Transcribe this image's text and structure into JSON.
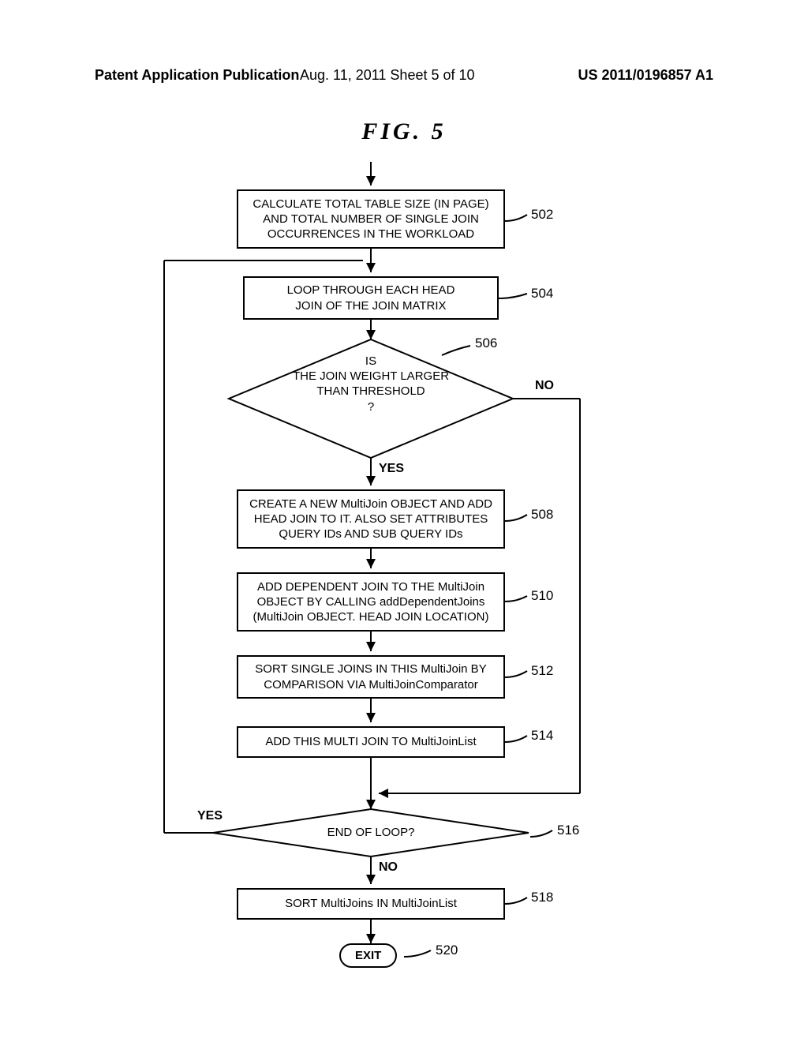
{
  "header": {
    "left": "Patent Application Publication",
    "center": "Aug. 11, 2011  Sheet 5 of 10",
    "right": "US 2011/0196857 A1"
  },
  "figure_label": "FIG.  5",
  "boxes": {
    "b502": "CALCULATE TOTAL TABLE SIZE (IN PAGE)\nAND TOTAL NUMBER OF SINGLE JOIN\nOCCURRENCES IN THE WORKLOAD",
    "b504": "LOOP THROUGH EACH HEAD\nJOIN OF THE JOIN MATRIX",
    "b506": "IS\nTHE JOIN WEIGHT LARGER\nTHAN THRESHOLD\n?",
    "b508": "CREATE A NEW MultiJoin OBJECT AND ADD\nHEAD JOIN TO IT. ALSO SET ATTRIBUTES\nQUERY IDs AND SUB QUERY IDs",
    "b510": "ADD DEPENDENT JOIN TO THE MultiJoin\nOBJECT BY CALLING addDependentJoins\n(MultiJoin OBJECT. HEAD JOIN LOCATION)",
    "b512": "SORT SINGLE JOINS IN THIS MultiJoin BY\nCOMPARISON VIA MultiJoinComparator",
    "b514": "ADD THIS MULTI JOIN TO MultiJoinList",
    "b516": "END OF LOOP?",
    "b518": "SORT MultiJoins IN MultiJoinList",
    "b520": "EXIT"
  },
  "refs": {
    "r502": "502",
    "r504": "504",
    "r506": "506",
    "r508": "508",
    "r510": "510",
    "r512": "512",
    "r514": "514",
    "r516": "516",
    "r518": "518",
    "r520": "520"
  },
  "labels": {
    "yes506": "YES",
    "no506": "NO",
    "yes516": "YES",
    "no516": "NO"
  }
}
